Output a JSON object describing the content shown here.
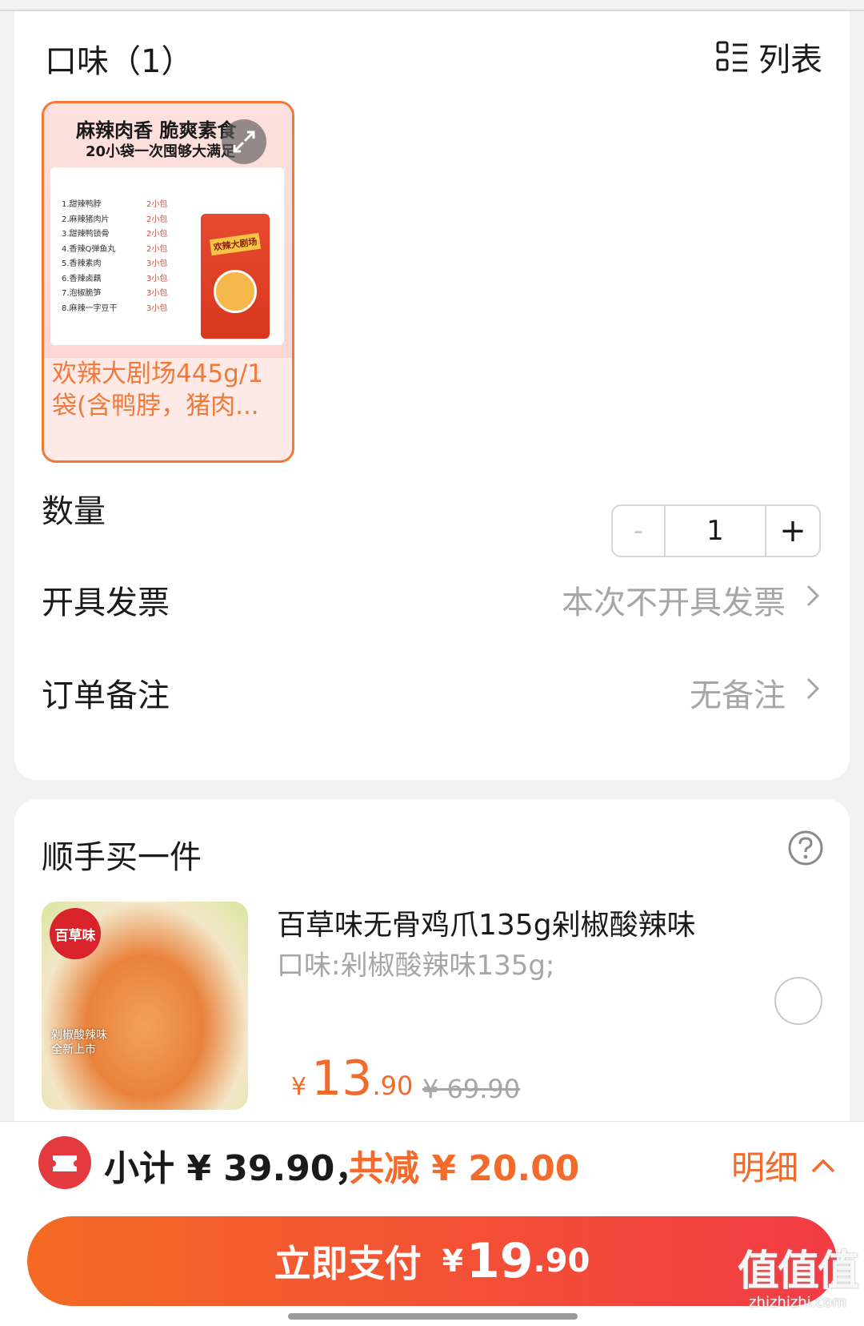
{
  "flavor_section": {
    "title": "口味（1）",
    "view_toggle_label": "列表",
    "product": {
      "image_headline": "麻辣肉香 脆爽素食",
      "image_subline": "20小袋一次囤够大满足",
      "image_list": [
        "1.甜辣鸭脖",
        "2.麻辣猪肉片",
        "3.甜辣鸭锁骨",
        "4.香辣Q弹鱼丸",
        "5.香辣素肉",
        "6.香辣卤藕",
        "7.泡椒脆笋",
        "8.麻辣一字豆干"
      ],
      "image_list_qty": [
        "2小包",
        "2小包",
        "2小包",
        "2小包",
        "3小包",
        "3小包",
        "3小包",
        "3小包"
      ],
      "bag_label": "欢辣大剧场",
      "name": "欢辣大剧场445g/1袋(含鸭脖，猪肉..."
    }
  },
  "quantity": {
    "label": "数量",
    "minus": "-",
    "value": "1",
    "plus": "+"
  },
  "invoice": {
    "label": "开具发票",
    "value": "本次不开具发票"
  },
  "remark": {
    "label": "订单备注",
    "value": "无备注"
  },
  "addon": {
    "title": "顺手买一件",
    "brand_badge": "百草味",
    "image_badge_line1": "剁椒酸辣味",
    "image_badge_line2": "全新上市",
    "name": "百草味无骨鸡爪135g剁椒酸辣味",
    "spec": "口味:剁椒酸辣味135g;",
    "price_currency": "¥",
    "price_int": "13",
    "price_dec": ".90",
    "original_price": "¥ 69.90",
    "selected": false
  },
  "summary": {
    "subtotal": "小计 ¥ 39.90，",
    "discount": "共减 ¥ 20.00",
    "detail_label": "明细"
  },
  "pay_button": {
    "label": "立即支付",
    "currency": "¥",
    "amount_int": "19",
    "amount_dec": ".90"
  },
  "watermark": {
    "main": "值值值",
    "sub": "zhizhizhi.com"
  },
  "colors": {
    "accent": "#f26b2a",
    "pay_start": "#f46a24",
    "pay_end": "#f23b45",
    "muted": "#a6a6a6"
  },
  "icons": [
    "list-view-icon",
    "expand-icon",
    "chevron-right-icon",
    "help-icon",
    "radio-unchecked-icon",
    "coupon-icon",
    "chevron-up-icon"
  ]
}
